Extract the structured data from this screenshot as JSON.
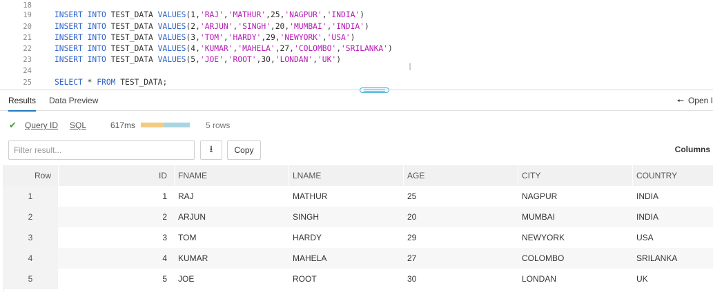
{
  "editor": {
    "lines": [
      {
        "num": "18",
        "tokens": []
      },
      {
        "num": "19",
        "tokens": [
          [
            "kw",
            "INSERT INTO "
          ],
          [
            "pun",
            "TEST_DATA "
          ],
          [
            "kw",
            "VALUES"
          ],
          [
            "pun",
            "("
          ],
          [
            "num",
            "1"
          ],
          [
            "pun",
            ","
          ],
          [
            "str",
            "'RAJ'"
          ],
          [
            "pun",
            ","
          ],
          [
            "str",
            "'MATHUR'"
          ],
          [
            "pun",
            ","
          ],
          [
            "num",
            "25"
          ],
          [
            "pun",
            ","
          ],
          [
            "str",
            "'NAGPUR'"
          ],
          [
            "pun",
            ","
          ],
          [
            "str",
            "'INDIA'"
          ],
          [
            "pun",
            ")"
          ]
        ]
      },
      {
        "num": "20",
        "tokens": [
          [
            "kw",
            "INSERT INTO "
          ],
          [
            "pun",
            "TEST_DATA "
          ],
          [
            "kw",
            "VALUES"
          ],
          [
            "pun",
            "("
          ],
          [
            "num",
            "2"
          ],
          [
            "pun",
            ","
          ],
          [
            "str",
            "'ARJUN'"
          ],
          [
            "pun",
            ","
          ],
          [
            "str",
            "'SINGH'"
          ],
          [
            "pun",
            ","
          ],
          [
            "num",
            "20"
          ],
          [
            "pun",
            ","
          ],
          [
            "str",
            "'MUMBAI'"
          ],
          [
            "pun",
            ","
          ],
          [
            "str",
            "'INDIA'"
          ],
          [
            "pun",
            ")"
          ]
        ]
      },
      {
        "num": "21",
        "tokens": [
          [
            "kw",
            "INSERT INTO "
          ],
          [
            "pun",
            "TEST_DATA "
          ],
          [
            "kw",
            "VALUES"
          ],
          [
            "pun",
            "("
          ],
          [
            "num",
            "3"
          ],
          [
            "pun",
            ","
          ],
          [
            "str",
            "'TOM'"
          ],
          [
            "pun",
            ","
          ],
          [
            "str",
            "'HARDY'"
          ],
          [
            "pun",
            ","
          ],
          [
            "num",
            "29"
          ],
          [
            "pun",
            ","
          ],
          [
            "str",
            "'NEWYORK'"
          ],
          [
            "pun",
            ","
          ],
          [
            "str",
            "'USA'"
          ],
          [
            "pun",
            ")"
          ]
        ]
      },
      {
        "num": "22",
        "tokens": [
          [
            "kw",
            "INSERT INTO "
          ],
          [
            "pun",
            "TEST_DATA "
          ],
          [
            "kw",
            "VALUES"
          ],
          [
            "pun",
            "("
          ],
          [
            "num",
            "4"
          ],
          [
            "pun",
            ","
          ],
          [
            "str",
            "'KUMAR'"
          ],
          [
            "pun",
            ","
          ],
          [
            "str",
            "'MAHELA'"
          ],
          [
            "pun",
            ","
          ],
          [
            "num",
            "27"
          ],
          [
            "pun",
            ","
          ],
          [
            "str",
            "'COLOMBO'"
          ],
          [
            "pun",
            ","
          ],
          [
            "str",
            "'SRILANKA'"
          ],
          [
            "pun",
            ")"
          ]
        ]
      },
      {
        "num": "23",
        "tokens": [
          [
            "kw",
            "INSERT INTO "
          ],
          [
            "pun",
            "TEST_DATA "
          ],
          [
            "kw",
            "VALUES"
          ],
          [
            "pun",
            "("
          ],
          [
            "num",
            "5"
          ],
          [
            "pun",
            ","
          ],
          [
            "str",
            "'JOE'"
          ],
          [
            "pun",
            ","
          ],
          [
            "str",
            "'ROOT'"
          ],
          [
            "pun",
            ","
          ],
          [
            "num",
            "30"
          ],
          [
            "pun",
            ","
          ],
          [
            "str",
            "'LONDAN'"
          ],
          [
            "pun",
            ","
          ],
          [
            "str",
            "'UK'"
          ],
          [
            "pun",
            ")"
          ]
        ]
      },
      {
        "num": "24",
        "tokens": []
      },
      {
        "num": "25",
        "tokens": [
          [
            "kw",
            "SELECT "
          ],
          [
            "pun",
            "* "
          ],
          [
            "kw",
            "FROM "
          ],
          [
            "pun",
            "TEST_DATA;"
          ]
        ]
      }
    ],
    "cursor_glyph": "I"
  },
  "tabs": [
    {
      "label": "Results",
      "active": true
    },
    {
      "label": "Data Preview",
      "active": false
    }
  ],
  "open_link": {
    "icon": "arrow-left-icon",
    "glyph": "🠔",
    "label": "Open I"
  },
  "status": {
    "icon": "check-icon",
    "check_glyph": "✔",
    "query_id_label": "Query ID",
    "sql_label": "SQL",
    "elapsed": "617ms",
    "progress_fraction": 0.48,
    "rows": "5 rows"
  },
  "toolbar": {
    "filter_placeholder": "Filter result...",
    "download_icon": "download-icon",
    "download_glyph": "⭳",
    "copy_label": "Copy",
    "columns_label": "Columns"
  },
  "colors": {
    "keyword": "#2c62c9",
    "string": "#b51bb5",
    "success": "#3aa33a",
    "progress_fill": "#f3ca81",
    "progress_track": "#a9d5e0",
    "tab_underline": "#1f78c1"
  },
  "table": {
    "headers": [
      "Row",
      "ID",
      "FNAME",
      "LNAME",
      "AGE",
      "CITY",
      "COUNTRY"
    ],
    "rows": [
      [
        "1",
        "1",
        "RAJ",
        "MATHUR",
        "25",
        "NAGPUR",
        "INDIA"
      ],
      [
        "2",
        "2",
        "ARJUN",
        "SINGH",
        "20",
        "MUMBAI",
        "INDIA"
      ],
      [
        "3",
        "3",
        "TOM",
        "HARDY",
        "29",
        "NEWYORK",
        "USA"
      ],
      [
        "4",
        "4",
        "KUMAR",
        "MAHELA",
        "27",
        "COLOMBO",
        "SRILANKA"
      ],
      [
        "5",
        "5",
        "JOE",
        "ROOT",
        "30",
        "LONDAN",
        "UK"
      ]
    ]
  }
}
